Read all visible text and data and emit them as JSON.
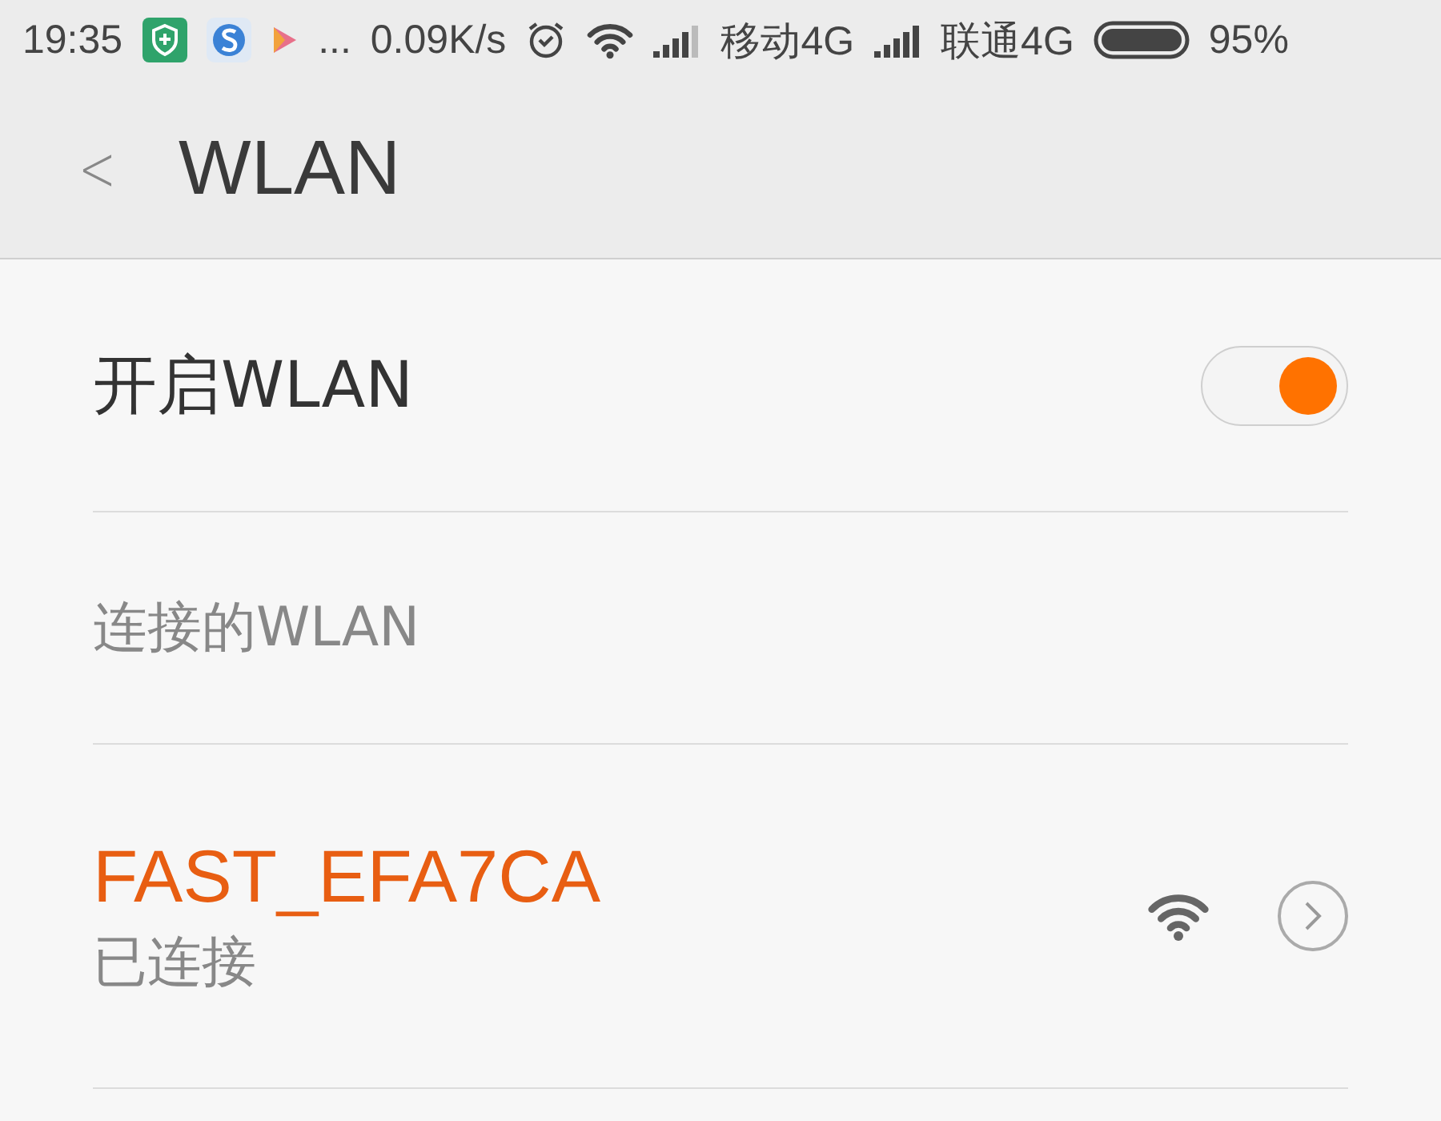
{
  "status_bar": {
    "time": "19:35",
    "dots": "...",
    "speed": "0.09K/s",
    "carrier_1": "移动4G",
    "carrier_2": "联通4G",
    "battery": "95%"
  },
  "header": {
    "back": "<",
    "title": "WLAN"
  },
  "wlan_toggle": {
    "label": "开启WLAN",
    "on": true
  },
  "section": {
    "title": "连接的WLAN"
  },
  "networks": [
    {
      "name": "FAST_EFA7CA",
      "status": "已连接",
      "connected": true
    }
  ]
}
